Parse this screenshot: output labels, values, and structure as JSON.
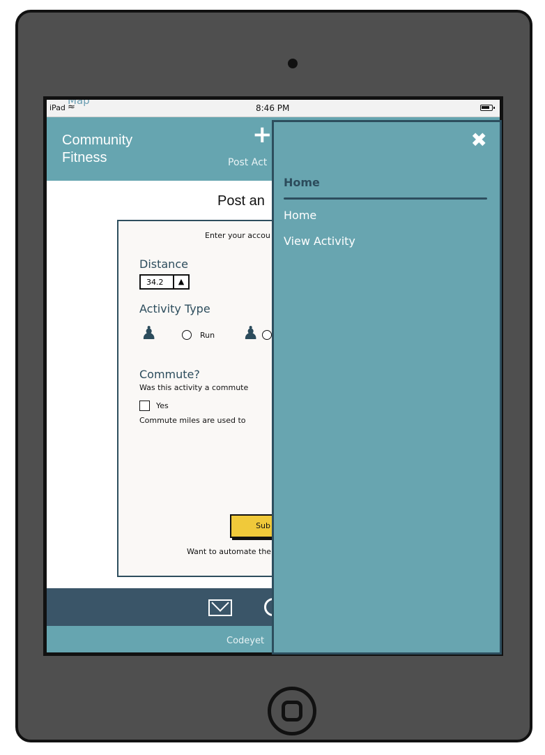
{
  "status_bar": {
    "carrier": "iPad",
    "ghost_label": "Map",
    "time": "8:46 PM"
  },
  "header": {
    "brand_line1": "Community",
    "brand_line2": "Fitness",
    "post_label": "Post Act"
  },
  "content": {
    "title": "Post an",
    "intro": "Enter your accou",
    "distance_label": "Distance",
    "distance_value": "34.2",
    "activity_type_label": "Activity Type",
    "activity_options": [
      "Run"
    ],
    "commute_label": "Commute?",
    "commute_question": "Was this activity a commute",
    "commute_yes_label": "Yes",
    "commute_note": "Commute miles are used to",
    "submit_label": "Sub",
    "automate_text": "Want to automate the"
  },
  "footer": {
    "copyright": "Codeyet"
  },
  "drawer": {
    "section_title": "Home",
    "items": [
      "Home",
      "View Activity"
    ]
  },
  "colors": {
    "header_bg": "#66a5b0",
    "drawer_bg": "#68a5b0",
    "footer_bg": "#3a5568",
    "text_dark": "#2c4c5c",
    "submit_bg": "#f0c93a"
  }
}
